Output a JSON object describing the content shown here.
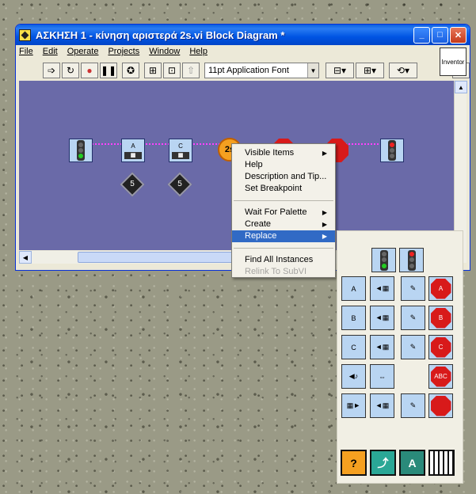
{
  "window": {
    "title": "ΑΣΚΗΣΗ 1 - κίνηση αριστερά 2s.vi Block Diagram *",
    "controls": {
      "minimize": "_",
      "maximize": "□",
      "close": "✕"
    }
  },
  "menubar": {
    "items": [
      {
        "label": "File"
      },
      {
        "label": "Edit"
      },
      {
        "label": "Operate"
      },
      {
        "label": "Projects"
      },
      {
        "label": "Window"
      },
      {
        "label": "Help"
      }
    ]
  },
  "toolbar": {
    "font_value": "11pt Application Font",
    "help_label": "?",
    "logo_label": "Inventor"
  },
  "diagram": {
    "nodes": [
      {
        "type": "traffic-light"
      },
      {
        "type": "motor",
        "port": "A",
        "constant": "5"
      },
      {
        "type": "motor",
        "port": "C",
        "constant": "5"
      },
      {
        "type": "timer",
        "label": "2s"
      },
      {
        "type": "stop"
      },
      {
        "type": "stop"
      },
      {
        "type": "traffic-light-red"
      }
    ]
  },
  "context_menu": {
    "items": [
      {
        "label": "Visible Items",
        "submenu": true
      },
      {
        "label": "Help"
      },
      {
        "label": "Description and Tip..."
      },
      {
        "label": "Set Breakpoint"
      },
      {
        "label": "Wait For Palette",
        "submenu": true
      },
      {
        "label": "Create",
        "submenu": true
      },
      {
        "label": "Replace",
        "submenu": true,
        "selected": true
      },
      {
        "label": "Find All Instances"
      },
      {
        "label": "Relink To SubVI",
        "disabled": true
      }
    ]
  },
  "palette": {
    "row_labels": [
      "A",
      "B",
      "C"
    ],
    "stop_labels": [
      "A",
      "B",
      "C",
      "ABC",
      ""
    ],
    "bottom_labels": [
      "?",
      "",
      "A",
      ""
    ]
  },
  "colors": {
    "diagram_bg": "#6a6aa8",
    "wire": "#ff40ff",
    "selection": "#316ac5",
    "titlebar": "#0054e3"
  }
}
